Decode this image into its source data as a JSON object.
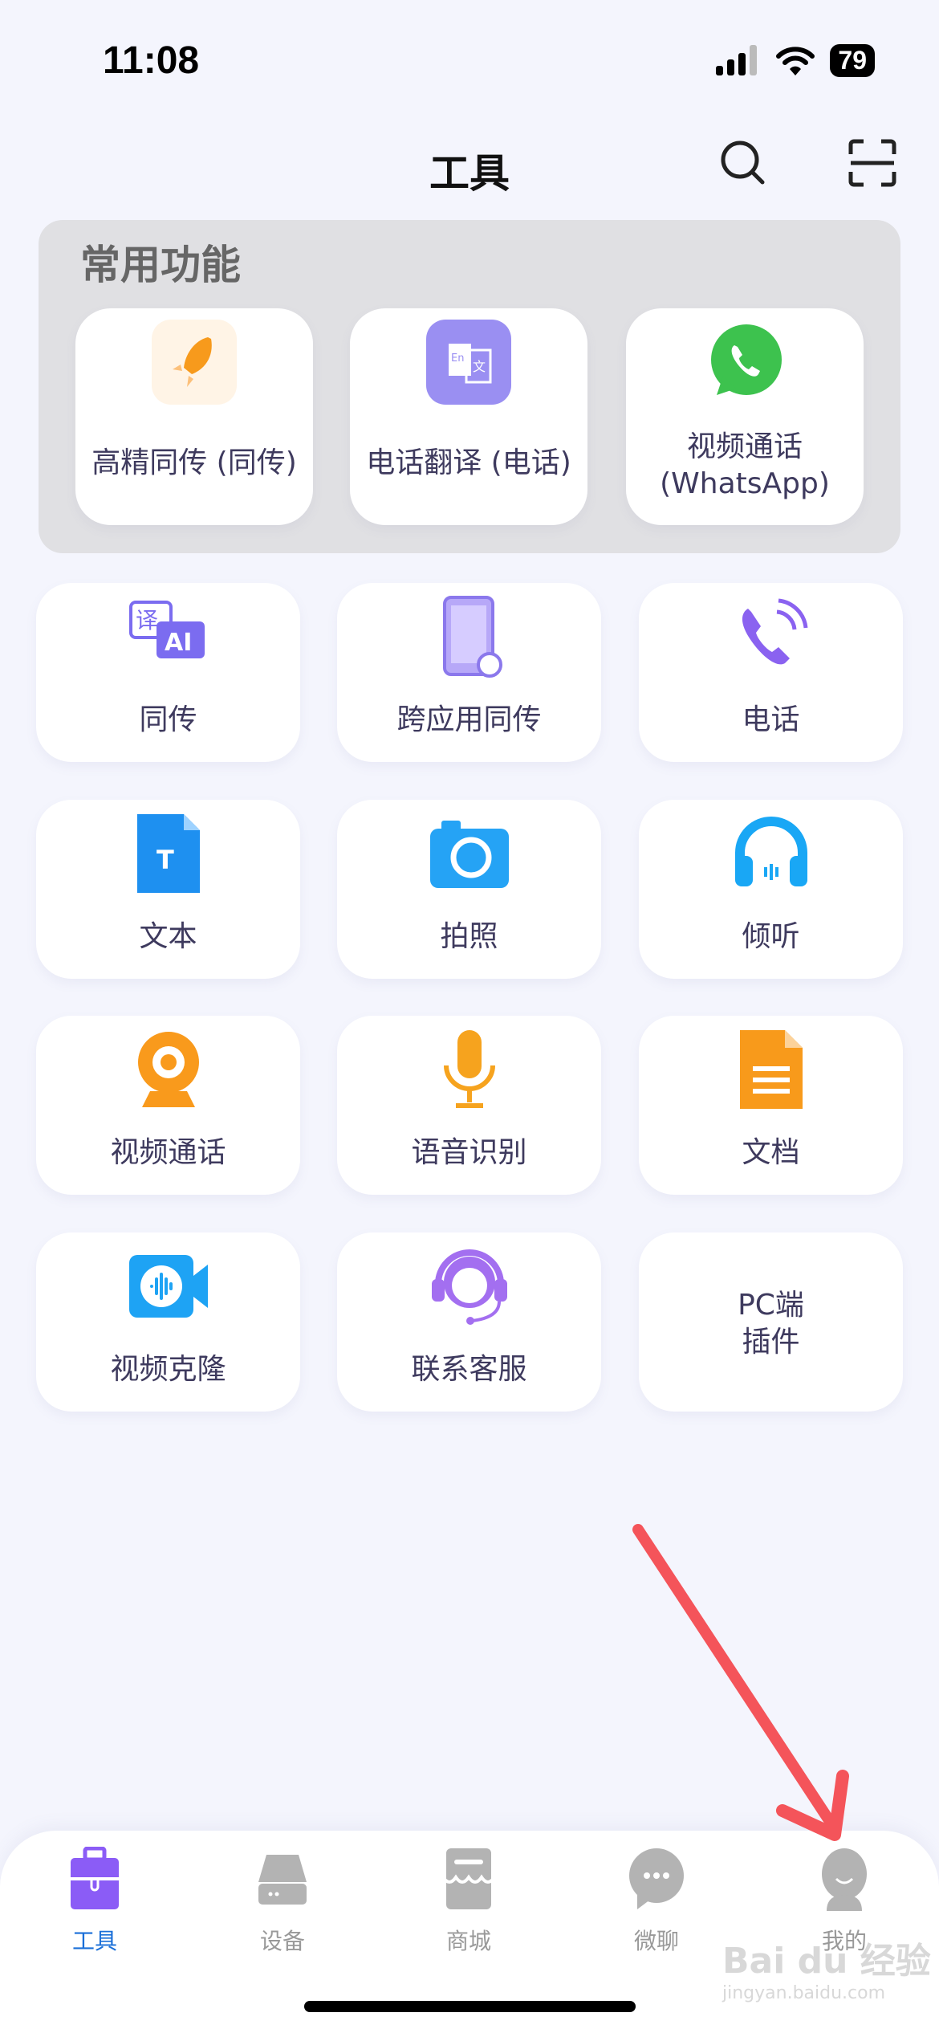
{
  "status_bar": {
    "time": "11:08",
    "battery": "79"
  },
  "header": {
    "title": "工具",
    "search_icon": "search-icon",
    "scan_icon": "scan-icon"
  },
  "favorites": {
    "title": "常用功能",
    "items": [
      {
        "label": "高精同传 (同传)",
        "icon": "rocket-icon"
      },
      {
        "label": "电话翻译 (电话)",
        "icon": "translate-icon"
      },
      {
        "label": "视频通话\n(WhatsApp)",
        "icon": "whatsapp-icon"
      }
    ]
  },
  "tools": [
    {
      "label": "同传",
      "icon": "ai-translate-icon"
    },
    {
      "label": "跨应用同传",
      "icon": "phone-app-icon"
    },
    {
      "label": "电话",
      "icon": "phone-call-icon"
    },
    {
      "label": "文本",
      "icon": "text-doc-icon"
    },
    {
      "label": "拍照",
      "icon": "camera-icon"
    },
    {
      "label": "倾听",
      "icon": "headphones-icon"
    },
    {
      "label": "视频通话",
      "icon": "webcam-icon"
    },
    {
      "label": "语音识别",
      "icon": "microphone-icon"
    },
    {
      "label": "文档",
      "icon": "document-icon"
    },
    {
      "label": "视频克隆",
      "icon": "video-clone-icon"
    },
    {
      "label": "联系客服",
      "icon": "customer-service-icon"
    },
    {
      "label": "PC端\n插件",
      "icon": ""
    }
  ],
  "tabbar": {
    "items": [
      {
        "label": "工具",
        "active": true
      },
      {
        "label": "设备"
      },
      {
        "label": "商城"
      },
      {
        "label": "微聊"
      },
      {
        "label": "我的"
      }
    ]
  },
  "watermark": {
    "brand": "Bai du 经验",
    "url": "jingyan.baidu.com"
  },
  "colors": {
    "accent": "#1a6fd8",
    "tool_active": "#8b5cf6",
    "inactive": "#b3b3b3",
    "annotation_arrow": "#f4545a"
  }
}
